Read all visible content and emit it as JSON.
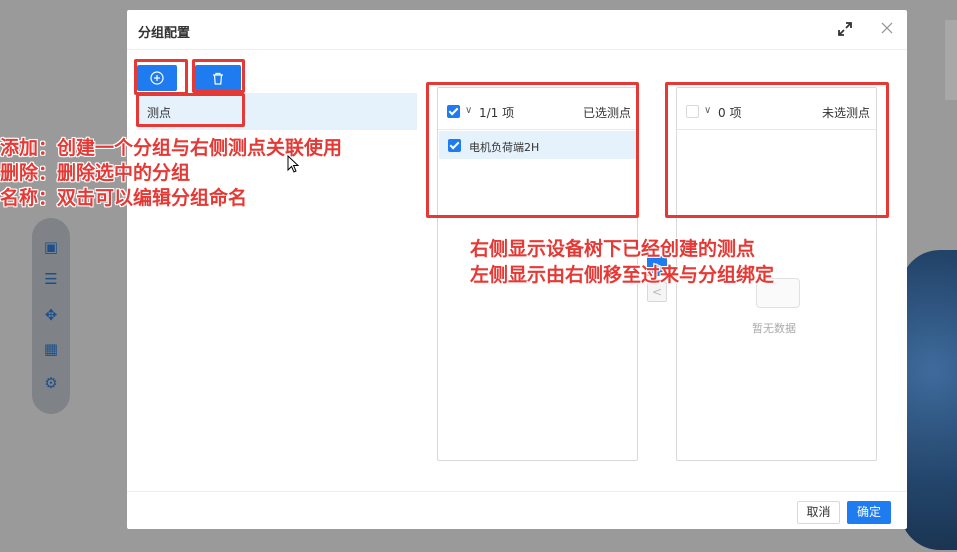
{
  "dialog": {
    "title": "分组配置",
    "icons": {
      "expand": "expand-arrows-icon",
      "close": "close-x-icon"
    }
  },
  "toolbar": {
    "add_icon": "plus-circle-icon",
    "delete_icon": "trash-icon"
  },
  "groups": [
    {
      "label": "测点"
    }
  ],
  "transfer": {
    "left": {
      "count": "1/1 项",
      "title": "已选测点",
      "items": [
        {
          "label": "电机负荷端2H",
          "checked": true
        }
      ]
    },
    "right": {
      "count": "0 项",
      "title": "未选测点",
      "empty_text": "暂无数据"
    }
  },
  "footer": {
    "cancel_label": "取消",
    "ok_label": "确定"
  },
  "annotations": {
    "left_lines": [
      "添加：创建一个分组与右侧测点关联使用",
      "删除：删除选中的分组",
      "名称：双击可以编辑分组命名"
    ],
    "mid_lines": [
      "右侧显示设备树下已经创建的测点",
      "左侧显示由右侧移至过来与分组绑定"
    ]
  },
  "colors": {
    "accent": "#1e7bf0",
    "annotation": "#e53935",
    "selected_row": "#e6f2fb"
  }
}
